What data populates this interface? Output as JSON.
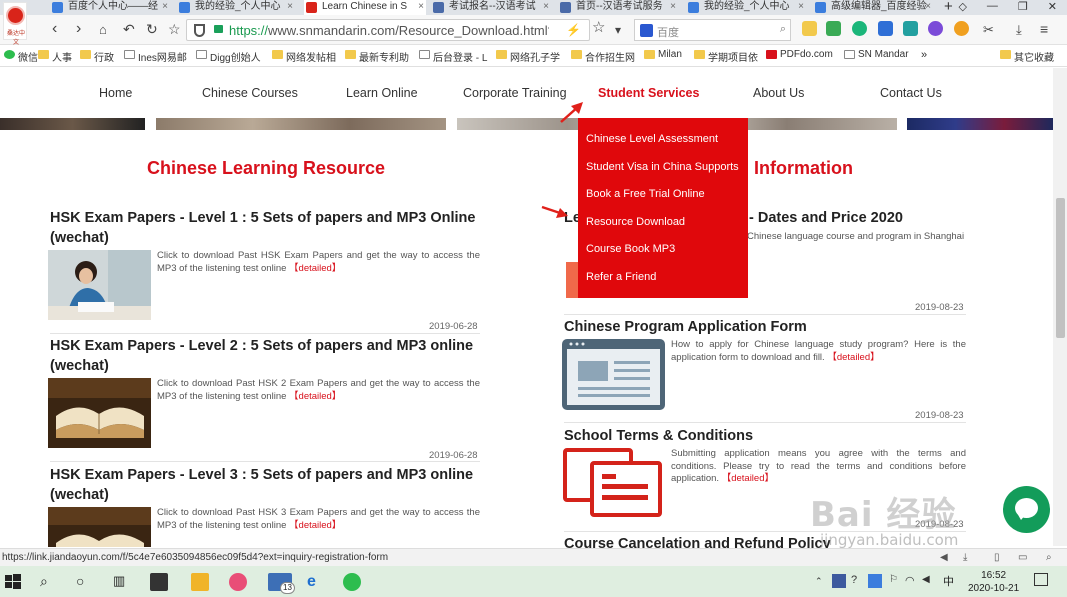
{
  "browser": {
    "tabs": [
      {
        "label": "百度个人中心——经"
      },
      {
        "label": "我的经验_个人中心"
      },
      {
        "label": "Learn Chinese in S"
      },
      {
        "label": "考试报名--汉语考试"
      },
      {
        "label": "首页--汉语考试服务"
      },
      {
        "label": "我的经验_个人中心"
      },
      {
        "label": "高级编辑器_百度经验"
      }
    ],
    "new_tab": "+",
    "url_prefix": "https://",
    "url_rest": "www.snmandarin.com/Resource_Download.html?articl",
    "search_placeholder": "百度",
    "bookmarks": [
      "微信",
      "人事",
      "行政",
      "Ines网易邮",
      "Digg创始人",
      "网络发帖相",
      "最新专利助",
      "后台登录 - L",
      "网络孔子学",
      "合作招生网",
      "Milan",
      "学期项目依",
      "PDFdo.com",
      "SN Mandar",
      "其它收藏"
    ],
    "logo_text": "桑达中文"
  },
  "site": {
    "nav": [
      "Home",
      "Chinese Courses",
      "Learn Online",
      "Corporate Training",
      "Student Services",
      "About Us",
      "Contact Us"
    ],
    "dropdown": [
      "Chinese Level Assessment",
      "Student Visa in China Supports",
      "Book a Free Trial Online",
      "Resource Download",
      "Course Book MP3",
      "Refer a Friend"
    ],
    "left_title": "Chinese Learning Resource",
    "right_title": "Information",
    "left_items": [
      {
        "title": "HSK Exam Papers - Level 1 : 5 Sets of papers and MP3 Online (wechat)",
        "desc": "Click to download Past HSK Exam Papers and get the way to access the MP3 of the listening test online",
        "more": "【detailed】",
        "date": "2019-06-28"
      },
      {
        "title": "HSK Exam Papers - Level 2 : 5 Sets of papers and MP3 online (wechat)",
        "desc": "Click to download Past HSK 2 Exam Papers and get the way to access the MP3 of the listening test online",
        "more": "【detailed】",
        "date": "2019-06-28"
      },
      {
        "title": "HSK Exam Papers - Level 3 : 5 Sets of papers and MP3 online (wechat)",
        "desc": "Click to download Past HSK 3 Exam Papers and get the way to access the MP3 of the listening test online",
        "more": "【detailed】"
      }
    ],
    "right_items": [
      {
        "title_start": "Le",
        "title_end": "- Dates and Price 2020",
        "desc": "Chinese language course and program in Shanghai",
        "date": "2019-08-23"
      },
      {
        "title": "Chinese Program Application Form",
        "desc": "How to apply for Chinese language study program? Here is the application form to download and fill.",
        "more": "【detailed】",
        "date": "2019-08-23"
      },
      {
        "title": "School Terms & Conditions",
        "desc": "Submitting application means you agree with the terms and conditions. Please try to read the terms and conditions before application.",
        "more": "【detailed】",
        "date": "2019-08-23"
      },
      {
        "title": "Course Cancelation and Refund Policy"
      }
    ]
  },
  "status": {
    "url": "https://link.jiandaoyun.com/f/5c4e7e6035094856ec09f5d4?ext=inquiry-registration-form"
  },
  "watermark": {
    "line1": "Bai 经验",
    "line2": "jingyan.baidu.com"
  },
  "taskbar": {
    "time": "16:52",
    "date": "2020-10-21",
    "mail_badge": "13",
    "ime": "中"
  },
  "colors": {
    "accent_red": "#d8111c",
    "dropdown_red": "#e0080c",
    "chat_green": "#139c5a"
  }
}
